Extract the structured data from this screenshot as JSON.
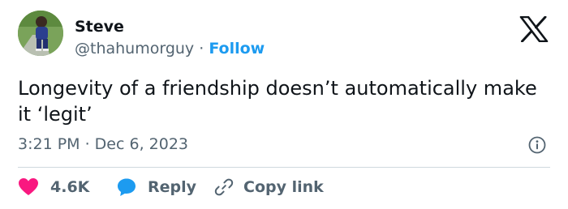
{
  "author": {
    "name": "Steve",
    "handle": "@thahumorguy",
    "separator": "·",
    "follow_label": "Follow"
  },
  "tweet": {
    "text": "Longevity of a friendship doesn’t automatically make it ‘legit’",
    "timestamp": "3:21 PM · Dec 6, 2023"
  },
  "actions": {
    "likes": "4.6K",
    "reply_label": "Reply",
    "copy_label": "Copy link"
  },
  "icons": {
    "logo": "x-logo-icon",
    "info": "info-icon",
    "like": "heart-icon",
    "reply": "speech-bubble-icon",
    "copy": "link-icon"
  },
  "colors": {
    "accent": "#1d9bf0",
    "like": "#f91880",
    "text": "#0f1419",
    "muted": "#536471",
    "divider": "#cfd9de"
  }
}
